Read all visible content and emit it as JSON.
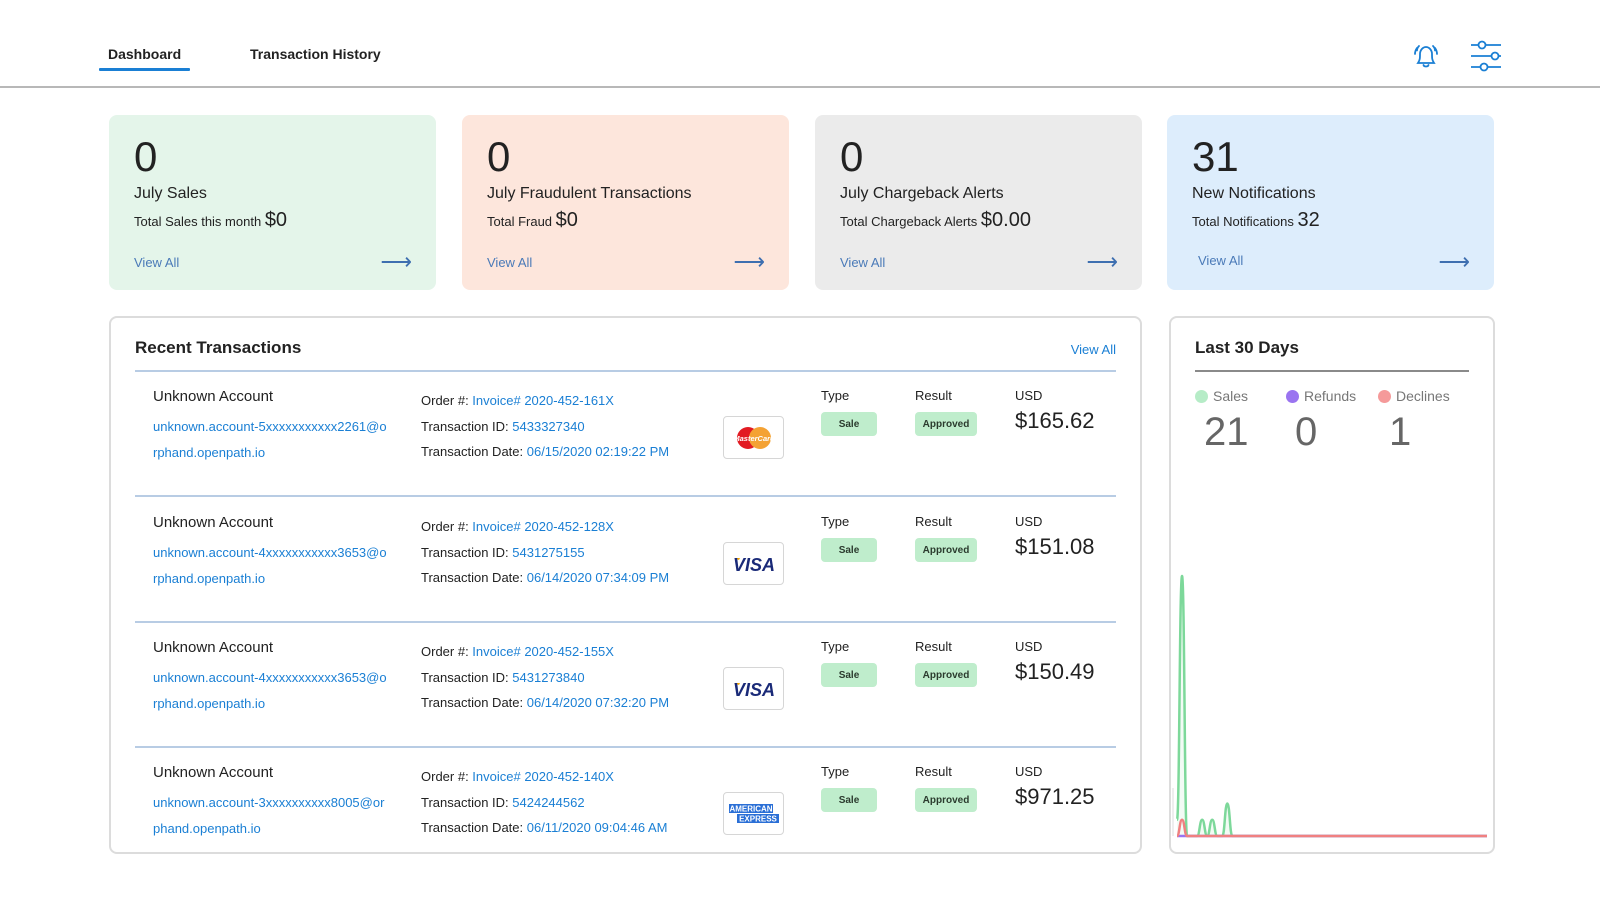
{
  "nav": {
    "tabs": [
      {
        "label": "Dashboard",
        "active": true
      },
      {
        "label": "Transaction History",
        "active": false
      }
    ],
    "icons": [
      "bell-icon",
      "sliders-icon"
    ],
    "accent": "#1a7fd4"
  },
  "stat_cards": [
    {
      "number": "0",
      "title": "July Sales",
      "sub_label": "Total Sales this month",
      "sub_amount": "$0",
      "link": "View All",
      "bg": "#e4f5ea"
    },
    {
      "number": "0",
      "title": "July Fraudulent Transactions",
      "sub_label": "Total Fraud",
      "sub_amount": "$0",
      "link": "View All",
      "bg": "#fde6dc"
    },
    {
      "number": "0",
      "title": "July Chargeback Alerts",
      "sub_label": "Total Chargeback Alerts",
      "sub_amount": "$0.00",
      "link": "View All",
      "bg": "#ebebeb"
    },
    {
      "number": "31",
      "title": "New Notifications",
      "sub_label": "Total Notifications",
      "sub_amount": "32",
      "link": "View All",
      "bg": "#ddedfc"
    }
  ],
  "recent_transactions": {
    "title": "Recent Transactions",
    "view_all": "View All",
    "labels": {
      "order": "Order #: ",
      "transaction_id": "Transaction ID: ",
      "transaction_date": "Transaction Date: ",
      "type": "Type",
      "result": "Result",
      "currency": "USD"
    },
    "rows": [
      {
        "account": "Unknown Account",
        "email": "unknown.account-5xxxxxxxxxxx2261@orphand.openpath.io",
        "order": "Invoice# 2020-452-161X",
        "transaction_id": "5433327340",
        "date": "06/15/2020 02:19:22 PM",
        "card": "mastercard",
        "type": "Sale",
        "result": "Approved",
        "amount": "$165.62"
      },
      {
        "account": "Unknown Account",
        "email": "unknown.account-4xxxxxxxxxxx3653@orphand.openpath.io",
        "order": "Invoice# 2020-452-128X",
        "transaction_id": "5431275155",
        "date": "06/14/2020 07:34:09 PM",
        "card": "visa",
        "type": "Sale",
        "result": "Approved",
        "amount": "$151.08"
      },
      {
        "account": "Unknown Account",
        "email": "unknown.account-4xxxxxxxxxxx3653@orphand.openpath.io",
        "order": "Invoice# 2020-452-155X",
        "transaction_id": "5431273840",
        "date": "06/14/2020 07:32:20 PM",
        "card": "visa",
        "type": "Sale",
        "result": "Approved",
        "amount": "$150.49"
      },
      {
        "account": "Unknown Account",
        "email": "unknown.account-3xxxxxxxxxx8005@orphand.openpath.io",
        "order": "Invoice# 2020-452-140X",
        "transaction_id": "5424244562",
        "date": "06/11/2020 09:04:46 AM",
        "card": "amex",
        "type": "Sale",
        "result": "Approved",
        "amount": "$971.25"
      }
    ],
    "card_text": {
      "mastercard": "MasterCard",
      "visa": "VISA",
      "amex_line1": "AMERICAN",
      "amex_line2": "EXPRESS"
    }
  },
  "last30": {
    "title": "Last 30 Days",
    "legend": [
      {
        "label": "Sales",
        "value": "21",
        "color": "#b6ecc7"
      },
      {
        "label": "Refunds",
        "value": "0",
        "color": "#9a74f0"
      },
      {
        "label": "Declines",
        "value": "1",
        "color": "#f59a9a"
      }
    ]
  },
  "chart_data": {
    "type": "area",
    "title": "Last 30 Days",
    "x": [
      1,
      2,
      3,
      4,
      5,
      6,
      7,
      8,
      9,
      10,
      11,
      12,
      13,
      14,
      15,
      16,
      17,
      18,
      19,
      20,
      21,
      22,
      23,
      24,
      25,
      26,
      27,
      28,
      29,
      30
    ],
    "series": [
      {
        "name": "Sales",
        "color": "#7dd89a",
        "values": [
          1,
          16,
          0,
          0,
          0,
          1,
          0,
          1,
          0,
          0,
          2,
          0,
          0,
          0,
          0,
          0,
          0,
          0,
          0,
          0,
          0,
          0,
          0,
          0,
          0,
          0,
          0,
          0,
          0,
          0
        ]
      },
      {
        "name": "Refunds",
        "color": "#9a74f0",
        "values": [
          0,
          0,
          0,
          0,
          0,
          0,
          0,
          0,
          0,
          0,
          0,
          0,
          0,
          0,
          0,
          0,
          0,
          0,
          0,
          0,
          0,
          0,
          0,
          0,
          0,
          0,
          0,
          0,
          0,
          0
        ]
      },
      {
        "name": "Declines",
        "color": "#f08080",
        "values": [
          0,
          1,
          0,
          0,
          0,
          0,
          0,
          0,
          0,
          0,
          0,
          0,
          0,
          0,
          0,
          0,
          0,
          0,
          0,
          0,
          0,
          0,
          0,
          0,
          0,
          0,
          0,
          0,
          0,
          0
        ]
      }
    ],
    "ylim": [
      0,
      16
    ],
    "grid": false,
    "xlabel": "",
    "ylabel": ""
  }
}
